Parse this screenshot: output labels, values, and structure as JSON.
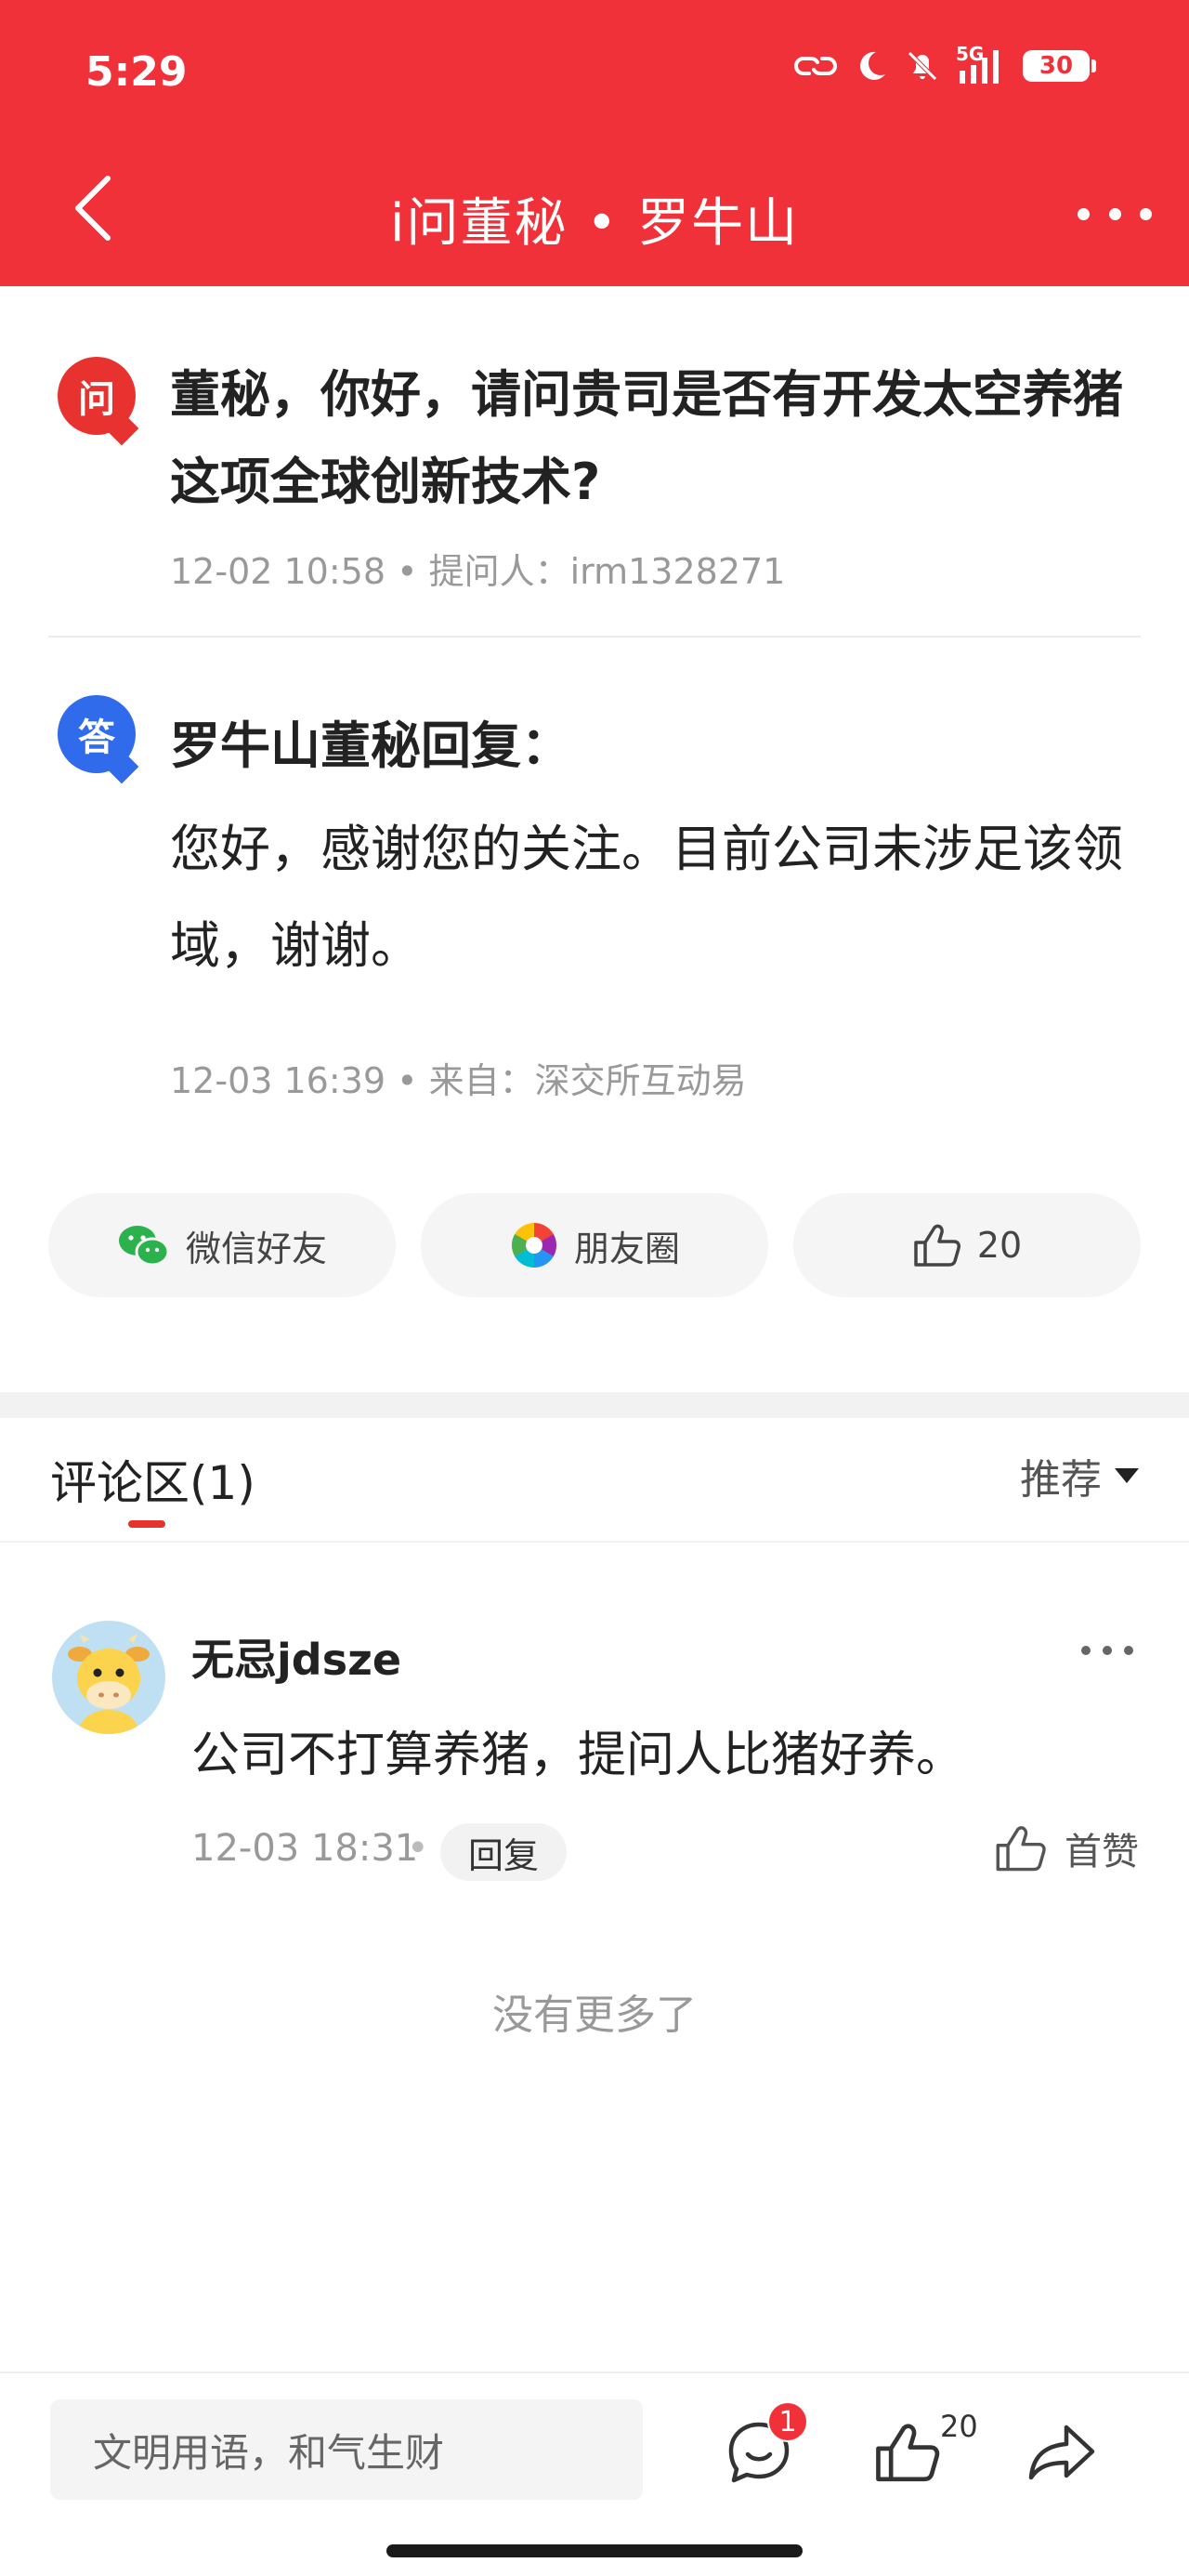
{
  "status_bar": {
    "time": "5:29",
    "network": "5G",
    "battery": "30",
    "icons": [
      "link-icon",
      "moon-icon",
      "bell-off-icon",
      "signal-icon",
      "battery-icon"
    ]
  },
  "header": {
    "title": "i问董秘 • 罗牛山",
    "background_color": "#F0313A"
  },
  "question": {
    "badge": "问",
    "text": "董秘，你好，请问贵司是否有开发太空养猪这项全球创新技术?",
    "meta": "12-02 10:58 • 提问人：irm1328271"
  },
  "answer": {
    "badge": "答",
    "heading": "罗牛山董秘回复：",
    "text": "您好，感谢您的关注。目前公司未涉足该领域，谢谢。",
    "meta": "12-03 16:39 • 来自：深交所互动易"
  },
  "share": {
    "wechat_label": "微信好友",
    "moments_label": "朋友圈",
    "like_count": "20"
  },
  "comments": {
    "title": "评论区(1)",
    "sort_label": "推荐",
    "items": [
      {
        "username": "无忌jdsze",
        "text": "公司不打算养猪，提问人比猪好养。",
        "time": "12-03 18:31",
        "separator": "•",
        "reply_label": "回复",
        "like_label": "首赞"
      }
    ],
    "no_more": "没有更多了"
  },
  "bottom_bar": {
    "input_placeholder": "文明用语，和气生财",
    "comment_badge": "1",
    "like_count": "20"
  }
}
